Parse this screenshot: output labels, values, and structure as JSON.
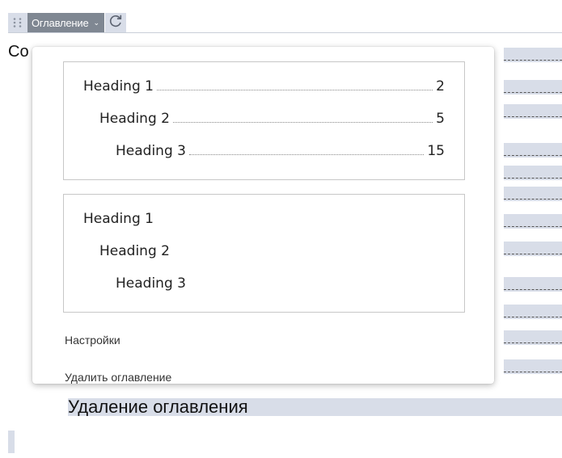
{
  "toolbar": {
    "toc_label": "Оглавление",
    "chevron_glyph": "⌄",
    "refresh_icon": "refresh-icon"
  },
  "document": {
    "heading_fragment": "Co",
    "last_line_text": "Удаление оглавления"
  },
  "dropdown": {
    "style_with_numbers": [
      {
        "text": "Heading 1",
        "page": "2"
      },
      {
        "text": "Heading 2",
        "page": "5"
      },
      {
        "text": "Heading 3",
        "page": "15"
      }
    ],
    "style_plain": [
      {
        "text": "Heading 1"
      },
      {
        "text": "Heading 2"
      },
      {
        "text": "Heading 3"
      }
    ],
    "settings_label": "Настройки",
    "remove_label": "Удалить оглавление"
  },
  "colors": {
    "toolbar_button": "#7f8792",
    "stripe": "#d8dde8"
  }
}
